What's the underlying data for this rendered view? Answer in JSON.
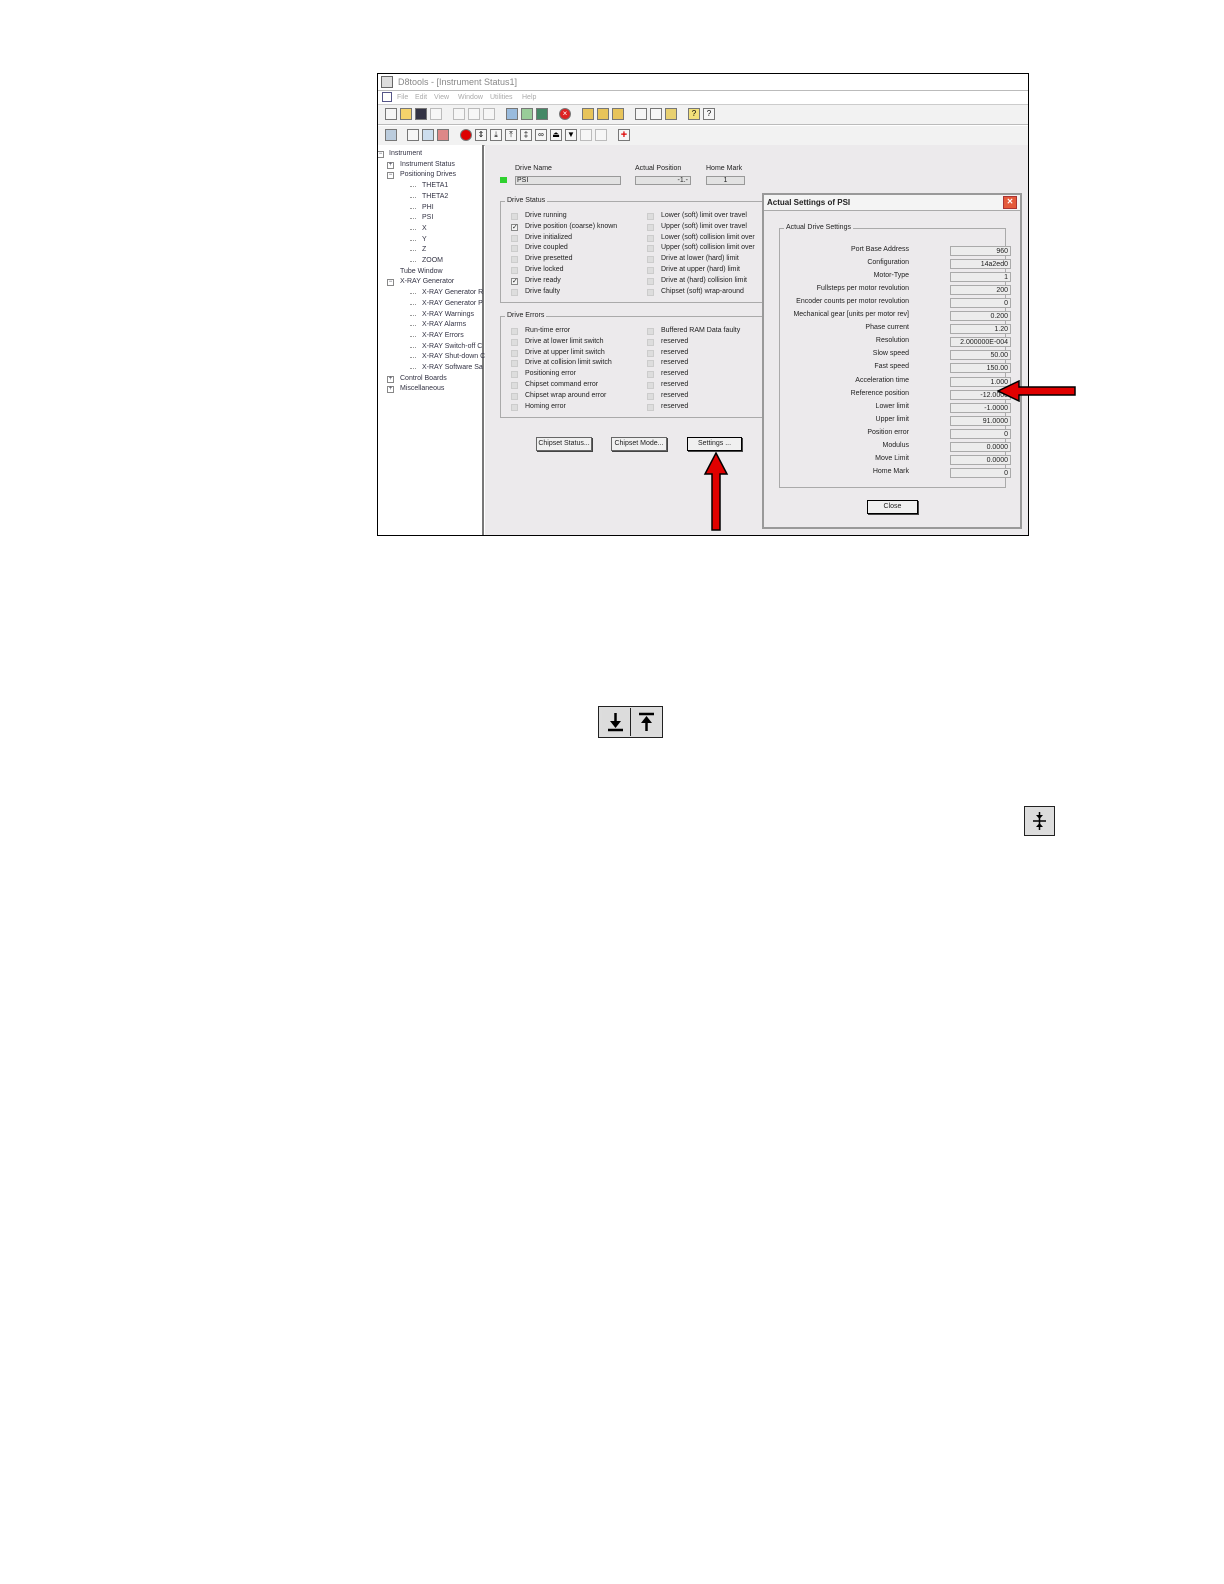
{
  "window": {
    "title": "D8tools - [Instrument Status1]",
    "menu": [
      "File",
      "Edit",
      "View",
      "Window",
      "Utilities",
      "Help"
    ]
  },
  "tree": {
    "items": [
      {
        "label": "Instrument",
        "level": 0,
        "expander": "-"
      },
      {
        "label": "Instrument Status",
        "level": 1,
        "expander": "+"
      },
      {
        "label": "Positioning Drives",
        "level": 1,
        "expander": "-"
      },
      {
        "label": "THETA1",
        "level": 2
      },
      {
        "label": "THETA2",
        "level": 2
      },
      {
        "label": "PHI",
        "level": 2
      },
      {
        "label": "PSI",
        "level": 2
      },
      {
        "label": "X",
        "level": 2
      },
      {
        "label": "Y",
        "level": 2
      },
      {
        "label": "Z",
        "level": 2
      },
      {
        "label": "ZOOM",
        "level": 2
      },
      {
        "label": "Tube Window",
        "level": 1
      },
      {
        "label": "X-RAY Generator",
        "level": 1,
        "expander": "-"
      },
      {
        "label": "X-RAY Generator R",
        "level": 2
      },
      {
        "label": "X-RAY Generator P",
        "level": 2
      },
      {
        "label": "X-RAY Warnings",
        "level": 2
      },
      {
        "label": "X-RAY Alarms",
        "level": 2
      },
      {
        "label": "X-RAY Errors",
        "level": 2
      },
      {
        "label": "X-RAY Switch-off C",
        "level": 2
      },
      {
        "label": "X-RAY Shut-down C",
        "level": 2
      },
      {
        "label": "X-RAY Software Sa",
        "level": 2
      },
      {
        "label": "Control Boards",
        "level": 1,
        "expander": "+"
      },
      {
        "label": "Miscellaneous",
        "level": 1,
        "expander": "+"
      }
    ]
  },
  "drive": {
    "name_label": "Drive Name",
    "name_value": "PSI",
    "position_label": "Actual Position",
    "position_value": "-1.-",
    "home_label": "Home Mark",
    "home_value": "1",
    "status_color": "#2fd12f"
  },
  "drive_status": {
    "title": "Drive Status",
    "left": [
      {
        "label": "Drive running",
        "checked": false
      },
      {
        "label": "Drive position (coarse) known",
        "checked": true
      },
      {
        "label": "Drive initialized",
        "checked": false
      },
      {
        "label": "Drive coupled",
        "checked": false
      },
      {
        "label": "Drive presetted",
        "checked": false
      },
      {
        "label": "Drive locked",
        "checked": false
      },
      {
        "label": "Drive ready",
        "checked": true
      },
      {
        "label": "Drive faulty",
        "checked": false
      }
    ],
    "right": [
      {
        "label": "Lower (soft) limit over travel",
        "checked": false
      },
      {
        "label": "Upper (soft) limit over travel",
        "checked": false
      },
      {
        "label": "Lower (soft) collision limit over",
        "checked": false
      },
      {
        "label": "Upper (soft) collision limit over",
        "checked": false
      },
      {
        "label": "Drive at lower (hard) limit",
        "checked": false
      },
      {
        "label": "Drive at upper (hard) limit",
        "checked": false
      },
      {
        "label": "Drive at (hard) collision limit",
        "checked": false
      },
      {
        "label": "Chipset (soft) wrap-around",
        "checked": false
      }
    ]
  },
  "drive_errors": {
    "title": "Drive Errors",
    "left": [
      {
        "label": "Run-time error"
      },
      {
        "label": "Drive at lower limit switch"
      },
      {
        "label": "Drive at upper limit switch"
      },
      {
        "label": "Drive at collision limit switch"
      },
      {
        "label": "Positioning error"
      },
      {
        "label": "Chipset command error"
      },
      {
        "label": "Chipset wrap around error"
      },
      {
        "label": "Homing error"
      }
    ],
    "right": [
      {
        "label": "Buffered RAM Data faulty"
      },
      {
        "label": "reserved"
      },
      {
        "label": "reserved"
      },
      {
        "label": "reserved"
      },
      {
        "label": "reserved"
      },
      {
        "label": "reserved"
      },
      {
        "label": "reserved"
      },
      {
        "label": "reserved"
      }
    ]
  },
  "buttons": {
    "chipset_status": "Chipset Status...",
    "chipset_mode": "Chipset Mode...",
    "settings": "Settings ..."
  },
  "dialog": {
    "title": "Actual Settings of PSI",
    "group_title": "Actual Drive Settings",
    "close_label": "Close",
    "settings": [
      {
        "label": "Port Base Address",
        "value": "960"
      },
      {
        "label": "Configuration",
        "value": "14a2ed0"
      },
      {
        "label": "Motor-Type",
        "value": "1"
      },
      {
        "label": "Fullsteps per motor revolution",
        "value": "200"
      },
      {
        "label": "Encoder counts per motor revolution",
        "value": "0"
      },
      {
        "label": "Mechanical gear [units per motor rev]",
        "value": "0.200"
      },
      {
        "label": "Phase current",
        "value": "1.20"
      },
      {
        "label": "Resolution",
        "value": "2.000000E-004"
      },
      {
        "label": "Slow speed",
        "value": "50.00"
      },
      {
        "label": "Fast speed",
        "value": "150.00"
      },
      {
        "label": "Acceleration time",
        "value": "1.000"
      },
      {
        "label": "Reference position",
        "value": "-12.0000"
      },
      {
        "label": "Lower limit",
        "value": "-1.0000"
      },
      {
        "label": "Upper limit",
        "value": "91.0000"
      },
      {
        "label": "Position error",
        "value": "0"
      },
      {
        "label": "Modulus",
        "value": "0.0000"
      },
      {
        "label": "Move Limit",
        "value": "0.0000"
      },
      {
        "label": "Home Mark",
        "value": "0"
      }
    ]
  },
  "icons": {
    "limit_icons": [
      "move-to-lower-limit-icon",
      "move-to-upper-limit-icon"
    ],
    "single_icon": "move-to-reference-icon"
  },
  "colors": {
    "arrow": "#e00000",
    "window_bg": "#eceaec"
  }
}
